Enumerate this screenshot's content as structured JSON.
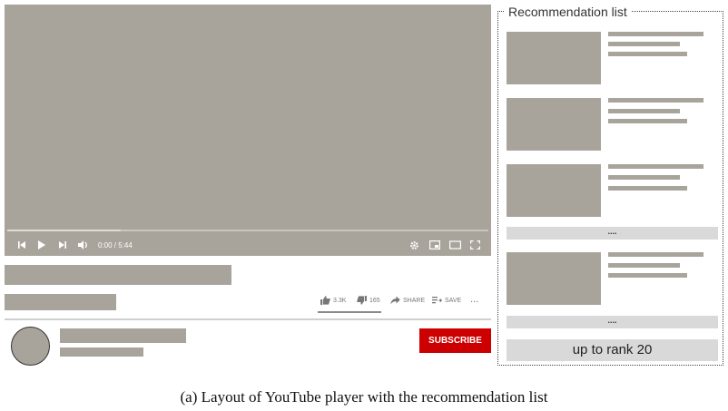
{
  "player": {
    "time_readout": "0:00 / 5:44",
    "icons": [
      "skip-previous-icon",
      "play-icon",
      "skip-next-icon",
      "volume-icon",
      "settings-gear-icon",
      "miniplayer-icon",
      "theater-mode-icon",
      "fullscreen-icon"
    ]
  },
  "actions": {
    "like_count": "3.3K",
    "dislike_count": "165",
    "share_label": "SHARE",
    "save_label": "SAVE",
    "more_label": "..."
  },
  "channel": {
    "subscribe_label": "SUBSCRIBE"
  },
  "recommendations": {
    "title": "Recommendation list",
    "ellipsis_1": "....",
    "ellipsis_2": "....",
    "rank_label": "up to rank 20"
  },
  "caption": "(a) Layout of YouTube player with the recommendation list",
  "colors": {
    "placeholder": "#a8a49b",
    "subscribe": "#cc0000",
    "light_bar": "#d9d9d9"
  }
}
